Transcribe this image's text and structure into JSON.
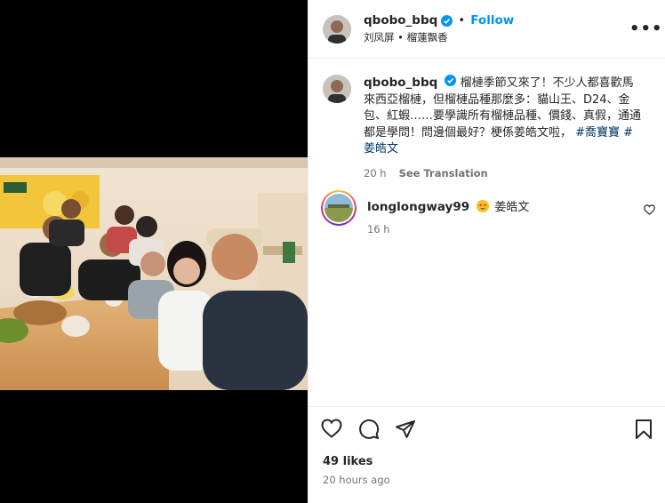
{
  "post": {
    "username": "qbobo_bbq",
    "follow_label": "Follow",
    "separator": "•",
    "subtitle": "刘凤屏 • 榴蓮飘香",
    "more_label": "•••"
  },
  "caption": {
    "username": "qbobo_bbq",
    "text": "榴槤季節又來了！不少人都喜歡馬來西亞榴槤，但榴槤品種那麼多：貓山王、D24、金包、紅蝦……要學識所有榴槤品種、價錢、真假，通通都是學問！問邊個最好？梗係姜皓文啦，",
    "hashtags": "#喬寶寶 #姜皓文",
    "time": "20 h",
    "translation": "See Translation"
  },
  "comment": {
    "username": "longlongway99",
    "text": "姜皓文",
    "time": "16 h"
  },
  "actions": {
    "likes": "49 likes",
    "posted": "20 hours ago"
  },
  "icons": {
    "like": "heart-icon",
    "comment": "comment-icon",
    "share": "paper-plane-icon",
    "save": "bookmark-icon",
    "verified": "verified-badge-icon",
    "emoji": "star-struck-emoji-icon"
  },
  "colors": {
    "follow": "#0095f6",
    "verified": "#0095f6",
    "hashtag": "#00376b",
    "muted": "#737373"
  }
}
